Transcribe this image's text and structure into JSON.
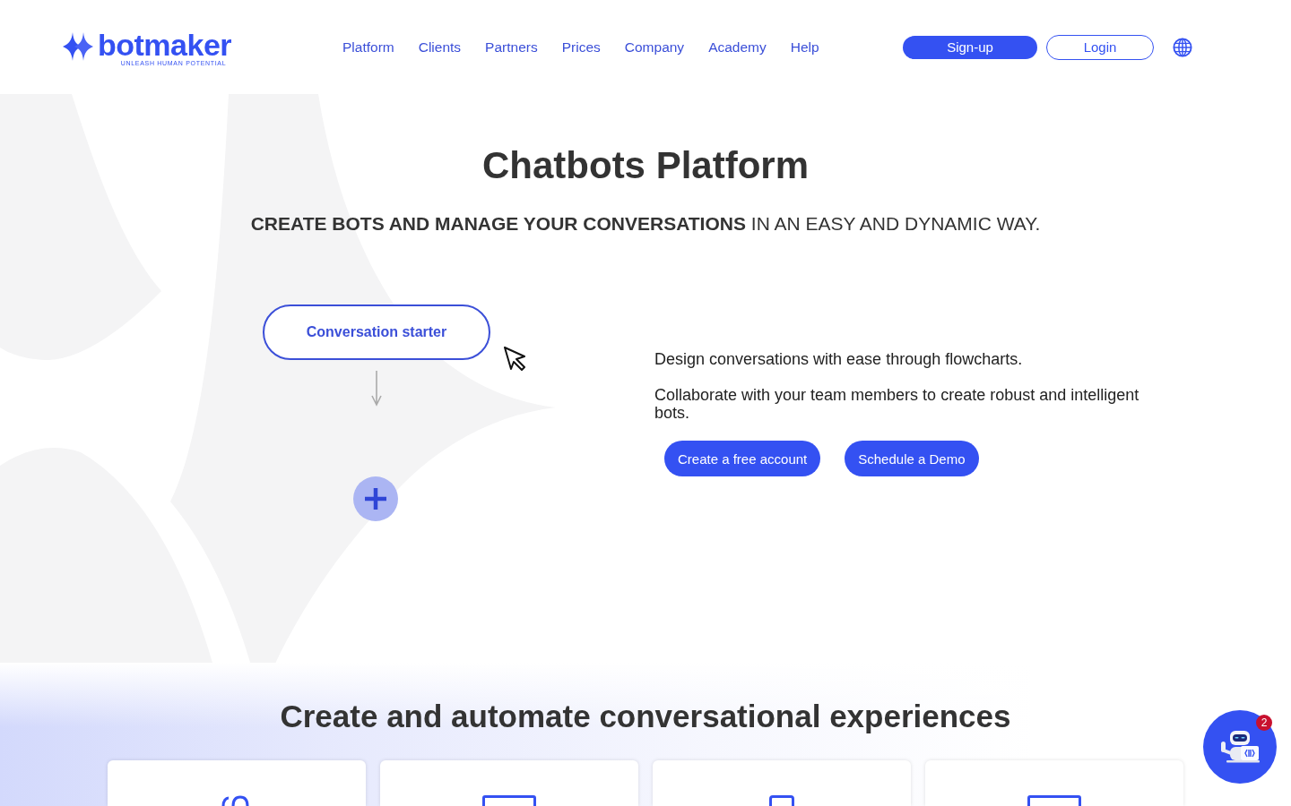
{
  "header": {
    "logo": {
      "name": "botmaker",
      "tagline": "UNLEASH HUMAN POTENTIAL"
    },
    "nav": [
      "Platform",
      "Clients",
      "Partners",
      "Prices",
      "Company",
      "Academy",
      "Help"
    ],
    "buttons": [
      {
        "label": "Sign-up",
        "kind": "filled"
      },
      {
        "label": "Login",
        "kind": "outline"
      }
    ]
  },
  "hero": {
    "title": "Chatbots Platform",
    "subtitle": "**CREATE BOTS AND MANAGE YOUR CONVERSATIONS** IN AN EASY AND DYNAMIC WAY.",
    "flow": {
      "start_node": "Conversation starter"
    },
    "paragraphs": [
      "Design conversations with ease through flowcharts.",
      "Collaborate with your team members to create robust and intelligent bots."
    ],
    "buttons": [
      {
        "label": "Create a free account"
      },
      {
        "label": "Schedule a Demo"
      }
    ]
  },
  "features": {
    "title": "Create and automate conversational experiences"
  },
  "chat_widget": {
    "badge": "2"
  }
}
